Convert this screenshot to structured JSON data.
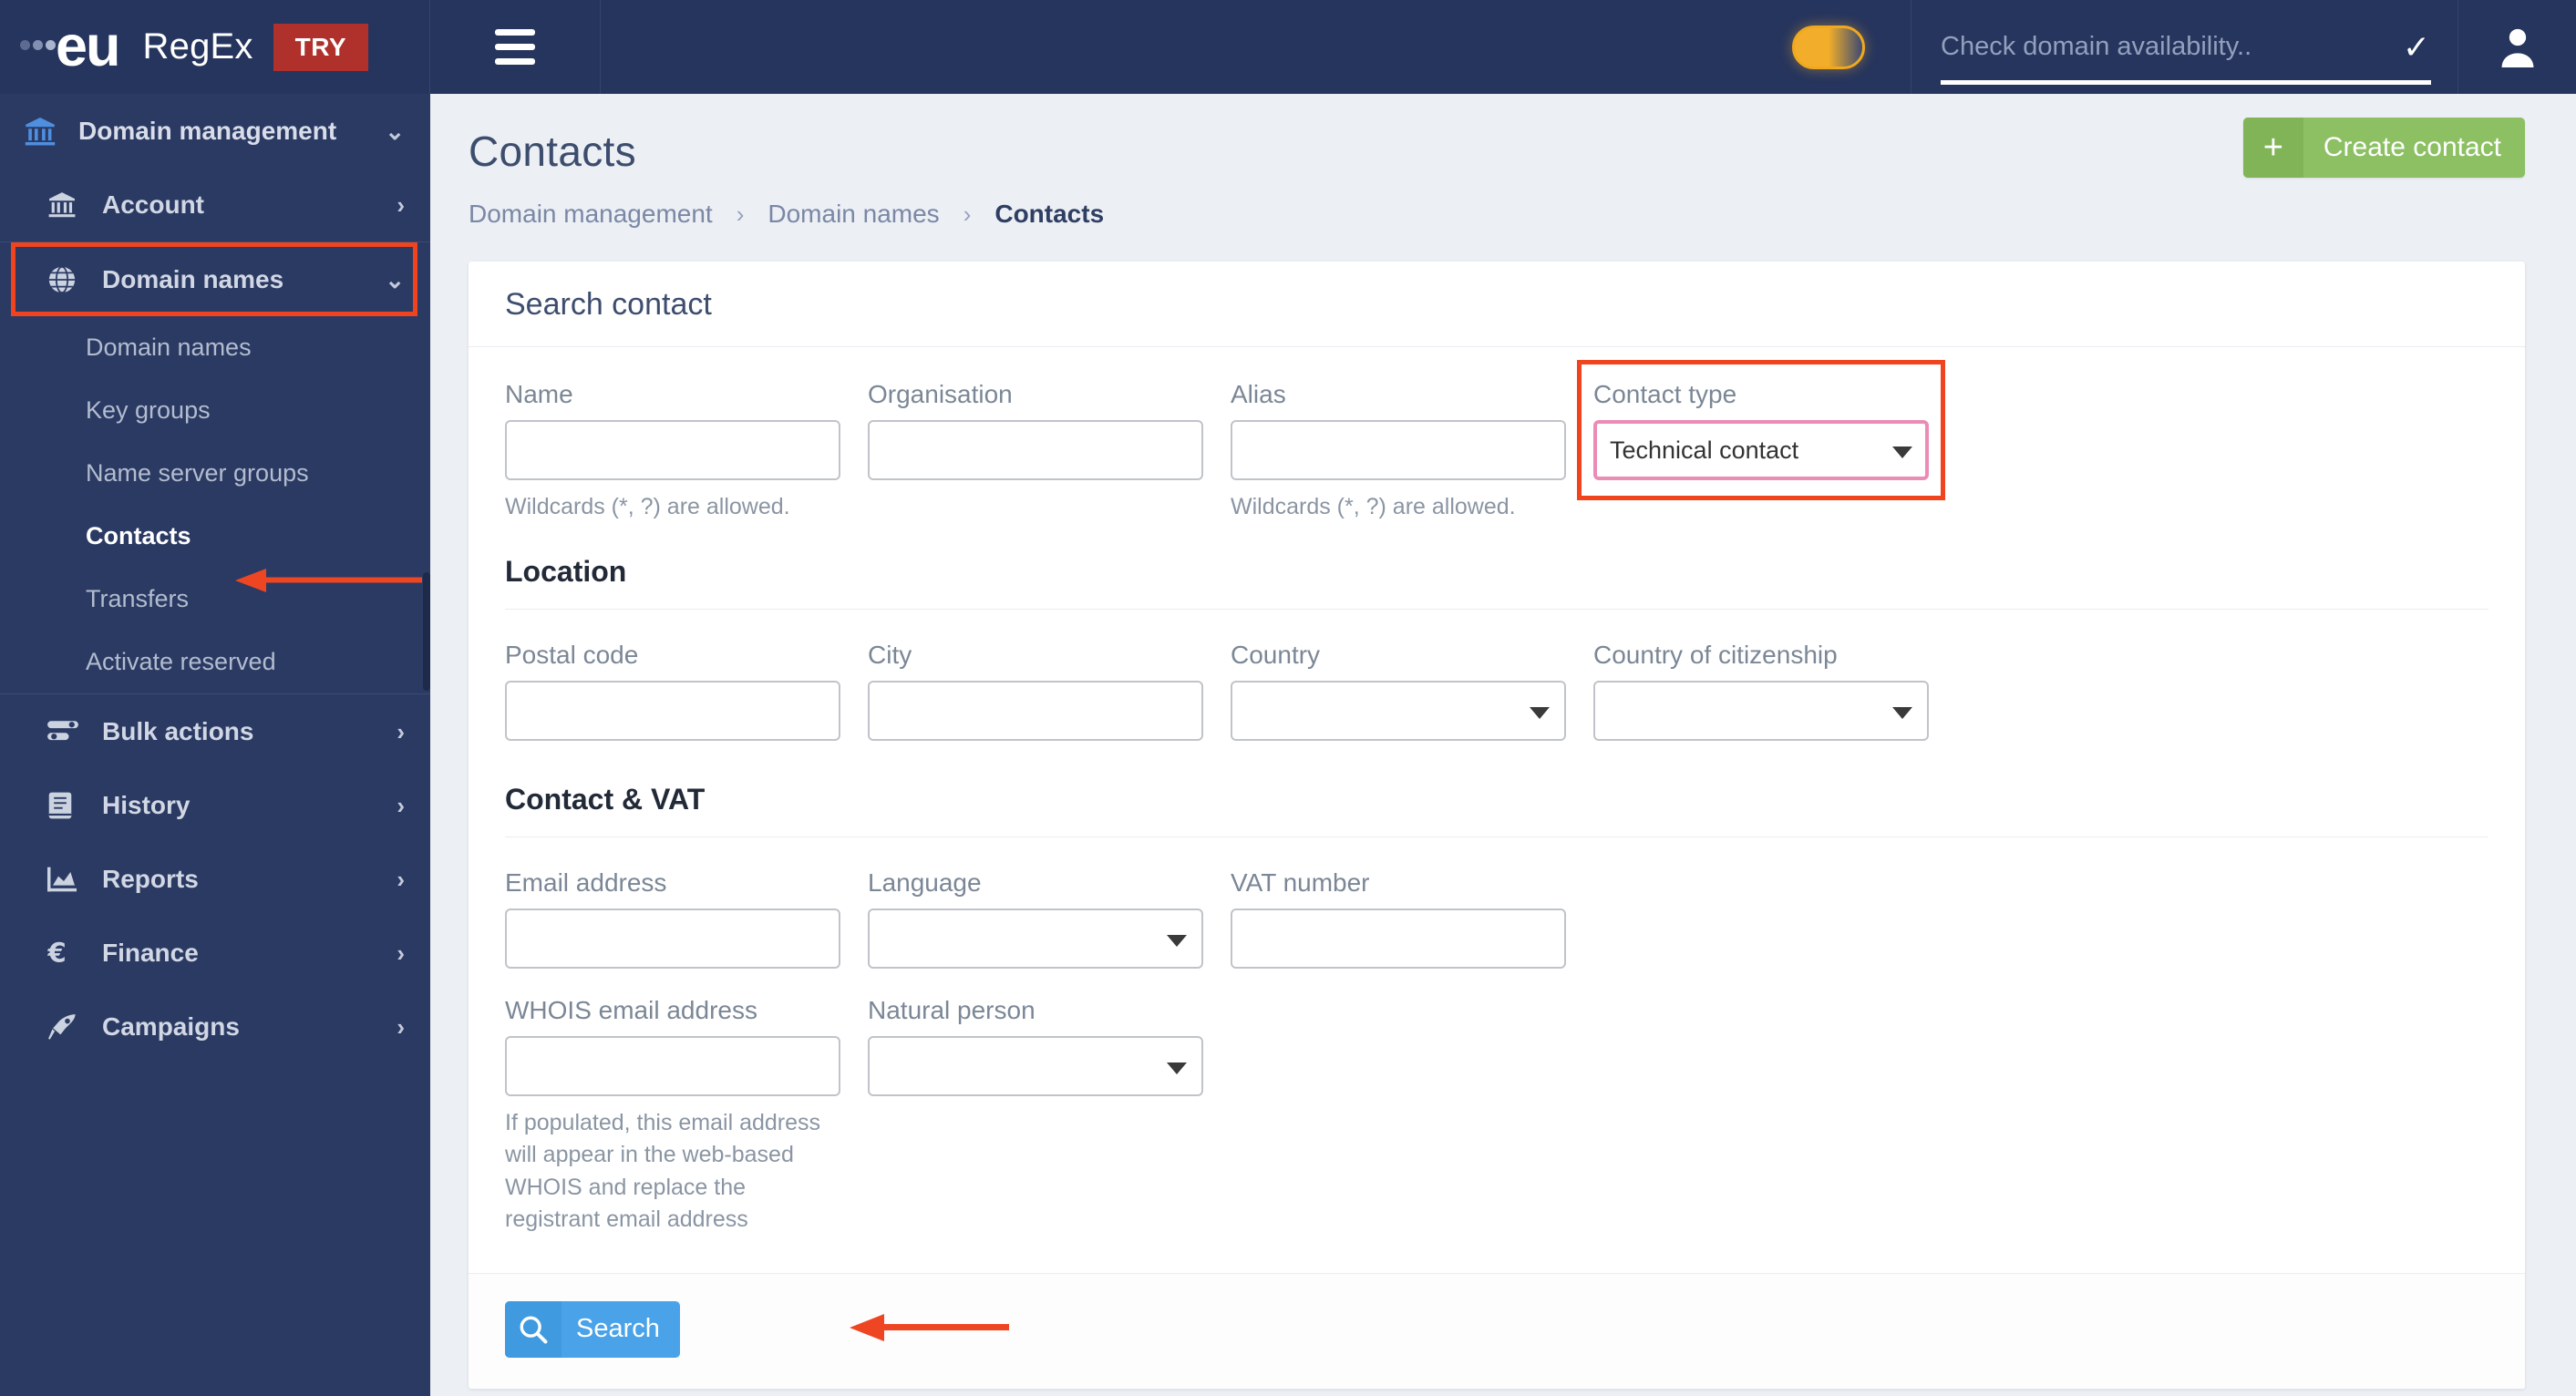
{
  "header": {
    "logo_dots": "logo-dots",
    "logo_text": "eu",
    "product_name": "RegEx",
    "try_badge": "TRY",
    "search_placeholder": "Check domain availability..",
    "search_value": "",
    "check_icon": "check-icon",
    "user_icon": "user-avatar-icon",
    "menu_icon": "hamburger-menu-icon",
    "toggle_icon": "theme-toggle"
  },
  "sidebar": {
    "root": {
      "label": "Domain management",
      "icon": "bank-icon",
      "chevron": "⌄"
    },
    "groups": [
      {
        "label": "Account",
        "icon": "bank-icon",
        "chevron": "›",
        "expanded": false,
        "highlighted": false
      },
      {
        "label": "Domain names",
        "icon": "globe-icon",
        "chevron": "⌄",
        "expanded": true,
        "highlighted": true
      }
    ],
    "sub_items": [
      {
        "label": "Domain names",
        "active": false
      },
      {
        "label": "Key groups",
        "active": false
      },
      {
        "label": "Name server groups",
        "active": false
      },
      {
        "label": "Contacts",
        "active": true
      },
      {
        "label": "Transfers",
        "active": false
      },
      {
        "label": "Activate reserved",
        "active": false
      }
    ],
    "bottom_groups": [
      {
        "label": "Bulk actions",
        "icon": "bulk-actions-icon",
        "chevron": "›"
      },
      {
        "label": "History",
        "icon": "book-icon",
        "chevron": "›"
      },
      {
        "label": "Reports",
        "icon": "chart-icon",
        "chevron": "›"
      },
      {
        "label": "Finance",
        "icon": "euro-icon",
        "chevron": "›"
      },
      {
        "label": "Campaigns",
        "icon": "rocket-icon",
        "chevron": "›"
      }
    ]
  },
  "page": {
    "title": "Contacts",
    "breadcrumb": [
      {
        "label": "Domain management",
        "current": false
      },
      {
        "label": "Domain names",
        "current": false
      },
      {
        "label": "Contacts",
        "current": true
      }
    ],
    "breadcrumb_separator": "›",
    "create_button": {
      "icon": "plus-icon",
      "label": "Create contact"
    }
  },
  "form": {
    "card_title": "Search contact",
    "row1": [
      {
        "label": "Name",
        "value": "",
        "hint": "Wildcards (*, ?) are allowed.",
        "type": "text"
      },
      {
        "label": "Organisation",
        "value": "",
        "hint": "",
        "type": "text"
      },
      {
        "label": "Alias",
        "value": "",
        "hint": "Wildcards (*, ?) are allowed.",
        "type": "text"
      },
      {
        "label": "Contact type",
        "value": "Technical contact",
        "hint": "",
        "type": "select",
        "highlighted": true
      }
    ],
    "location_title": "Location",
    "row2": [
      {
        "label": "Postal code",
        "value": "",
        "type": "text"
      },
      {
        "label": "City",
        "value": "",
        "type": "text"
      },
      {
        "label": "Country",
        "value": "",
        "type": "select"
      },
      {
        "label": "Country of citizenship",
        "value": "",
        "type": "select"
      }
    ],
    "contact_vat_title": "Contact & VAT",
    "row3": [
      {
        "label": "Email address",
        "value": "",
        "type": "text"
      },
      {
        "label": "Language",
        "value": "",
        "type": "select"
      },
      {
        "label": "VAT number",
        "value": "",
        "type": "text"
      }
    ],
    "row4": [
      {
        "label": "WHOIS email address",
        "value": "",
        "type": "text",
        "hint": "If populated, this email address will appear in the web-based WHOIS and replace the registrant email address"
      },
      {
        "label": "Natural person",
        "value": "",
        "type": "select"
      }
    ],
    "search_button": {
      "icon": "search-icon",
      "label": "Search"
    }
  },
  "colors": {
    "header_bg": "#26355e",
    "sidebar_bg": "#2b3a63",
    "main_bg": "#eceff4",
    "accent_green": "#8cc063",
    "accent_blue": "#4aa3e8",
    "annotation_red": "#f0431e",
    "highlight_pink": "#eb8cb6",
    "try_red": "#b0302b",
    "toggle_amber": "#f2ae2a"
  }
}
